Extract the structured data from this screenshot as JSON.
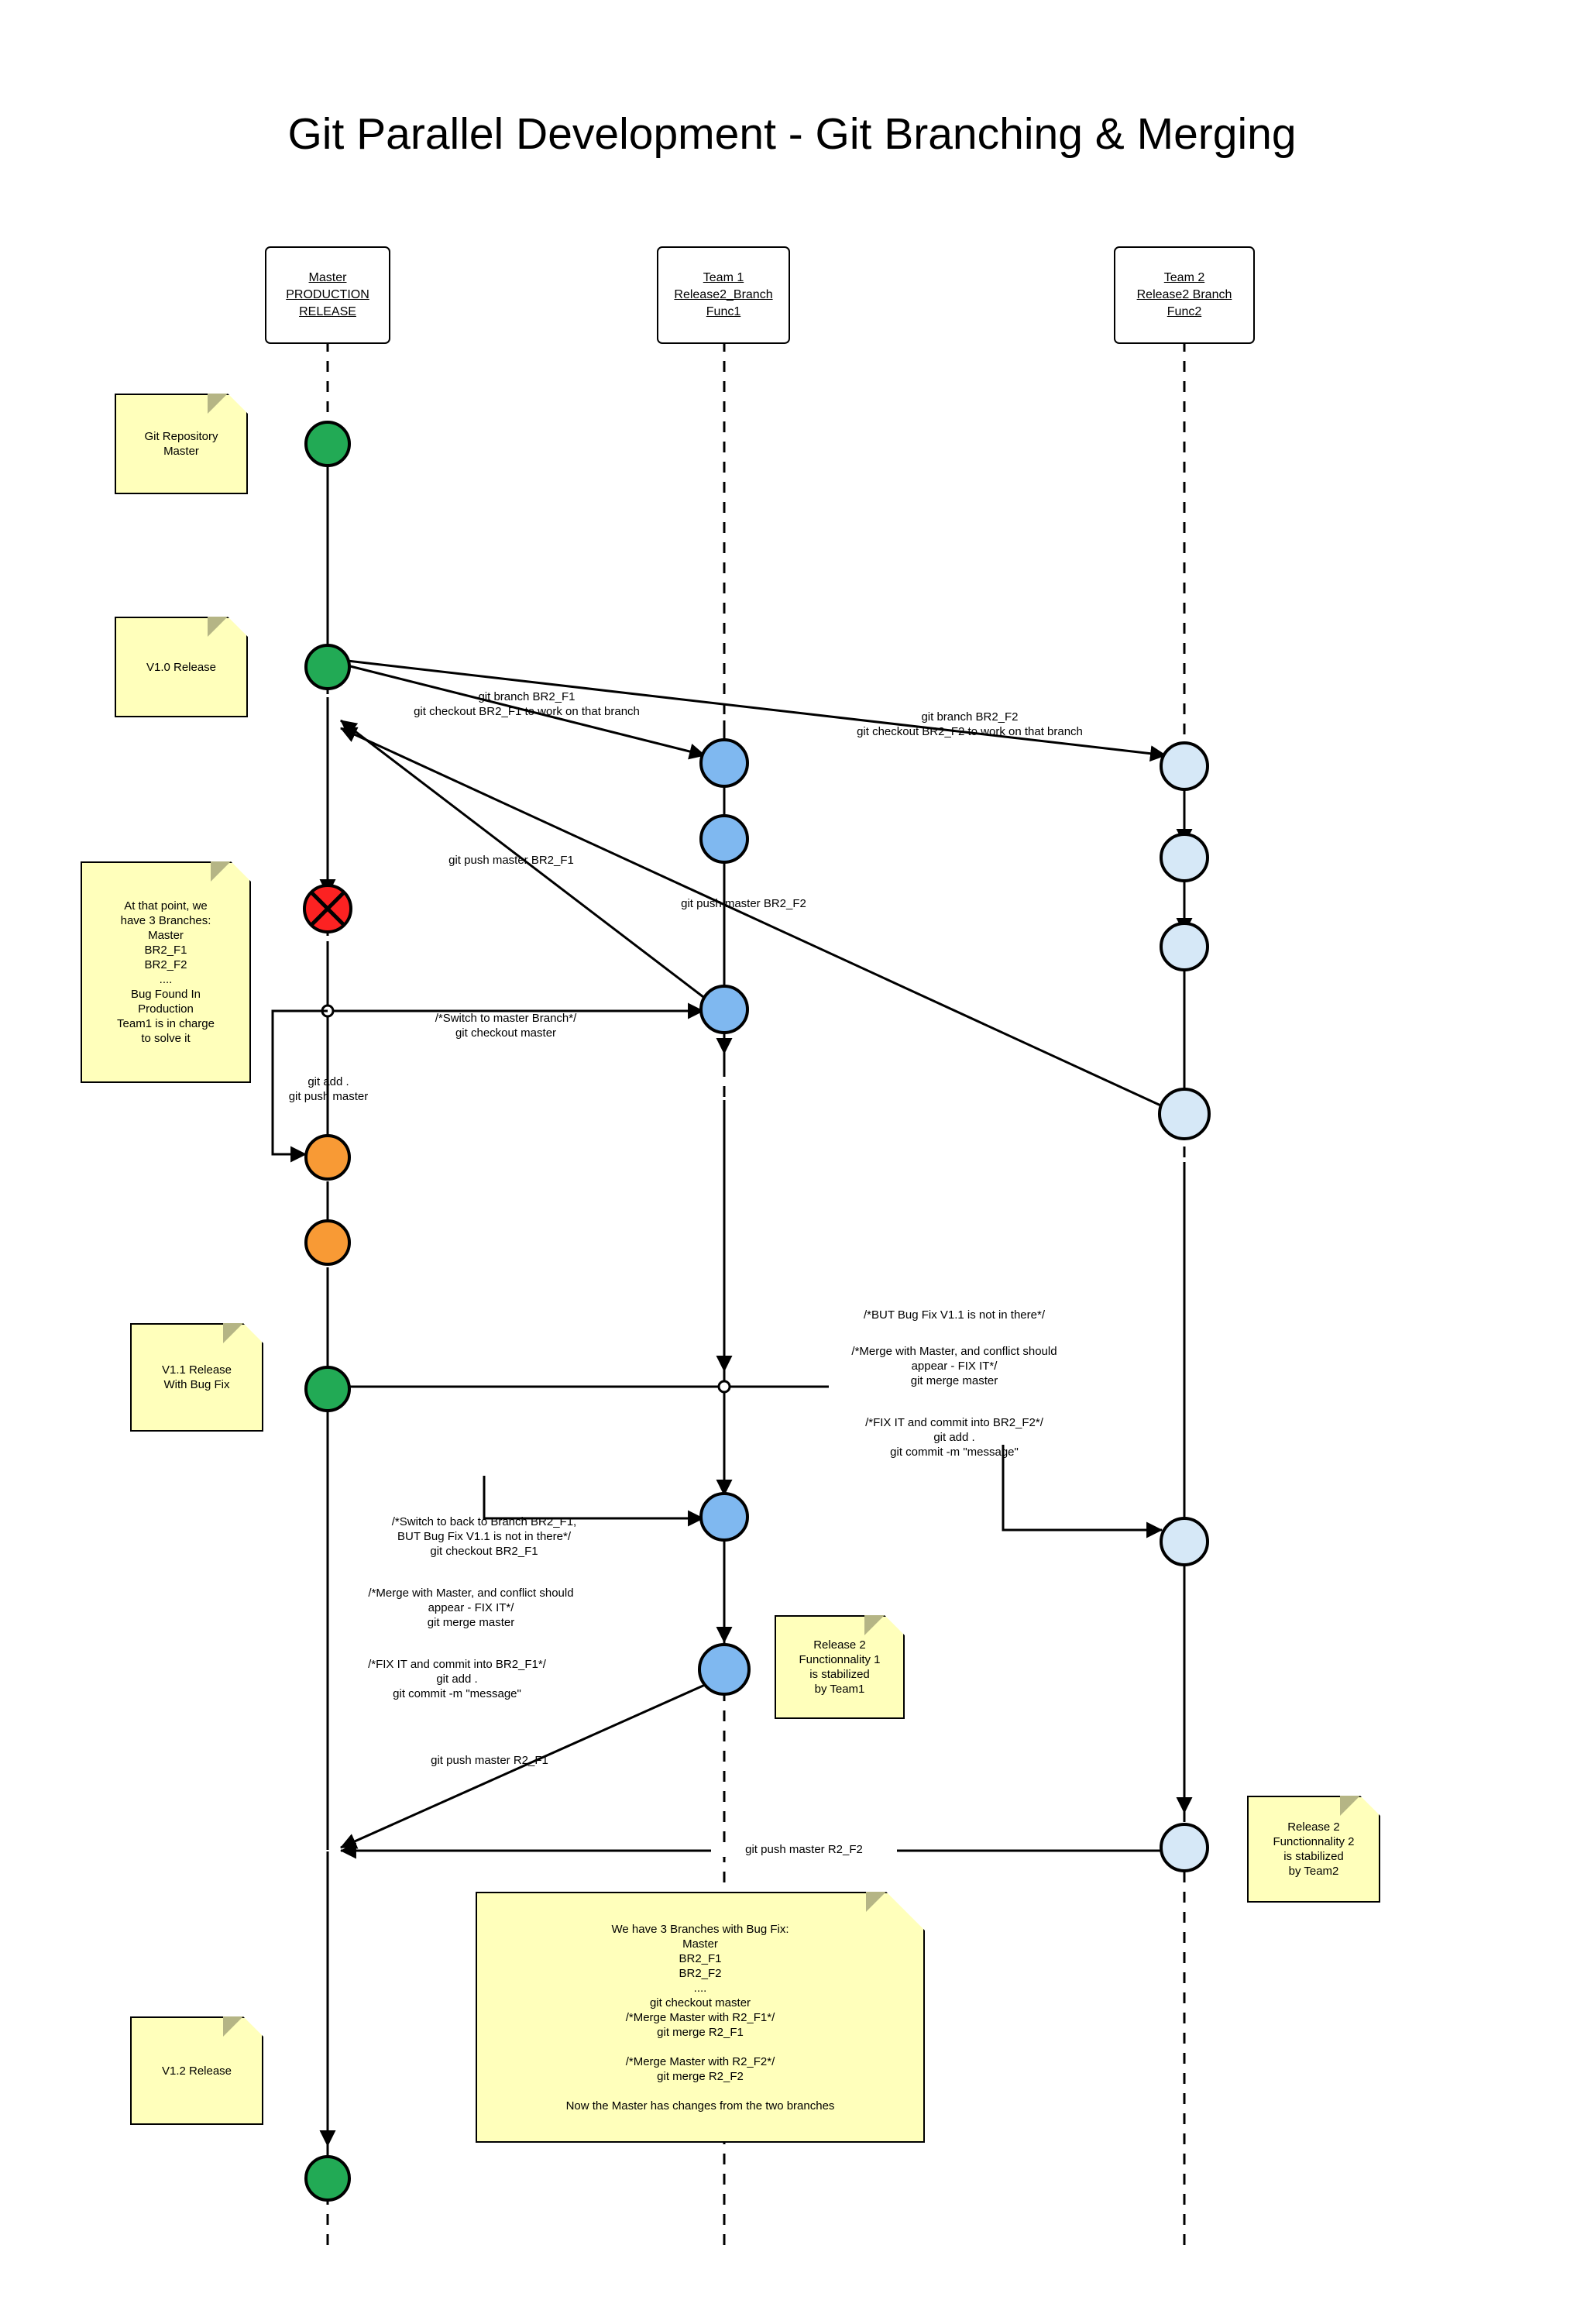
{
  "title": "Git Parallel Development - Git Branching & Merging",
  "colors": {
    "master_node": "#22aa55",
    "bug_node": "#fc2222",
    "fix_node": "#f89a35",
    "team1_node": "#7fb8f0",
    "team2_node": "#d6e8f7",
    "note_bg": "#ffffbb",
    "note_fold": "#b5b585",
    "stroke": "#000000",
    "background": "#ffffff"
  },
  "lifelines": [
    {
      "id": "master",
      "lines": [
        "Master",
        "PRODUCTION",
        "RELEASE"
      ]
    },
    {
      "id": "team1",
      "lines": [
        "Team 1",
        "Release2_Branch",
        "Func1"
      ]
    },
    {
      "id": "team2",
      "lines": [
        "Team 2",
        "Release2 Branch",
        "Func2"
      ]
    }
  ],
  "notes": [
    {
      "id": "git-repository-master",
      "text": "Git Repository\nMaster"
    },
    {
      "id": "v10-release",
      "text": "V1.0 Release"
    },
    {
      "id": "three-branches",
      "text": "At that point, we\nhave 3 Branches:\nMaster\nBR2_F1\nBR2_F2\n....\nBug Found In\nProduction\nTeam1 is in charge\nto solve it"
    },
    {
      "id": "v11-release",
      "text": "V1.1 Release\nWith Bug Fix"
    },
    {
      "id": "release2-func1",
      "text": "Release 2\nFunctionnality 1\nis stabilized\nby Team1"
    },
    {
      "id": "release2-func2",
      "text": "Release 2\nFunctionnality 2\nis stabilized\nby Team2"
    },
    {
      "id": "merge-summary",
      "text": "We have 3 Branches with Bug Fix:\nMaster\nBR2_F1\nBR2_F2\n....\ngit checkout master\n/*Merge Master with R2_F1*/\ngit merge R2_F1\n\n/*Merge Master with R2_F2*/\ngit merge R2_F2\n\nNow the Master has changes from the two branches"
    },
    {
      "id": "v12-release",
      "text": "V1.2 Release"
    }
  ],
  "edge_labels": [
    {
      "id": "branch-br2-f1",
      "text": "git branch BR2_F1\ngit checkout BR2_F1 to work on that branch"
    },
    {
      "id": "branch-br2-f2",
      "text": "git branch BR2_F2\ngit checkout BR2_F2 to work on that branch"
    },
    {
      "id": "push-master-br2-f1",
      "text": "git push master BR2_F1"
    },
    {
      "id": "push-master-br2-f2",
      "text": "git push master BR2_F2"
    },
    {
      "id": "switch-to-master",
      "text": "/*Switch to master Branch*/\ngit checkout master"
    },
    {
      "id": "git-add-push-master",
      "text": "git add .\ngit push master"
    },
    {
      "id": "bugfix-not-in-there-f2",
      "text": "/*BUT Bug Fix V1.1 is not in there*/"
    },
    {
      "id": "merge-master-conflict-f2",
      "text": "/*Merge with Master, and conflict should\nappear  - FIX IT*/\ngit merge master"
    },
    {
      "id": "fix-commit-br2-f2",
      "text": "/*FIX IT and commit into BR2_F2*/\ngit add .\ngit commit -m \"message\""
    },
    {
      "id": "switch-back-br2-f1",
      "text": "/*Switch to back to Branch BR2_F1,\nBUT Bug Fix V1.1 is not in there*/\ngit checkout BR2_F1"
    },
    {
      "id": "merge-master-conflict-f1",
      "text": "/*Merge with Master, and conflict should\nappear  - FIX IT*/\ngit merge master"
    },
    {
      "id": "fix-commit-br2-f1",
      "text": "/*FIX IT and commit into BR2_F1*/\ngit add .\ngit commit -m \"message\""
    },
    {
      "id": "push-master-r2-f1",
      "text": "git push master R2_F1"
    },
    {
      "id": "push-master-r2-f2",
      "text": "git push master R2_F2"
    }
  ],
  "nodes": [
    {
      "id": "master-initial",
      "lifeline": "master",
      "kind": "release"
    },
    {
      "id": "master-v10",
      "lifeline": "master",
      "kind": "release"
    },
    {
      "id": "master-bug",
      "lifeline": "master",
      "kind": "bug"
    },
    {
      "id": "master-fix-1",
      "lifeline": "master",
      "kind": "fix"
    },
    {
      "id": "master-fix-2",
      "lifeline": "master",
      "kind": "fix"
    },
    {
      "id": "master-v11",
      "lifeline": "master",
      "kind": "release"
    },
    {
      "id": "master-v12",
      "lifeline": "master",
      "kind": "release"
    },
    {
      "id": "team1-commit-1",
      "lifeline": "team1",
      "kind": "team1"
    },
    {
      "id": "team1-commit-2",
      "lifeline": "team1",
      "kind": "team1"
    },
    {
      "id": "team1-commit-3",
      "lifeline": "team1",
      "kind": "team1"
    },
    {
      "id": "team1-commit-4",
      "lifeline": "team1",
      "kind": "team1"
    },
    {
      "id": "team1-commit-5",
      "lifeline": "team1",
      "kind": "team1"
    },
    {
      "id": "team2-commit-1",
      "lifeline": "team2",
      "kind": "team2"
    },
    {
      "id": "team2-commit-2",
      "lifeline": "team2",
      "kind": "team2"
    },
    {
      "id": "team2-commit-3",
      "lifeline": "team2",
      "kind": "team2"
    },
    {
      "id": "team2-commit-4",
      "lifeline": "team2",
      "kind": "team2"
    },
    {
      "id": "team2-commit-5",
      "lifeline": "team2",
      "kind": "team2"
    },
    {
      "id": "team2-commit-6",
      "lifeline": "team2",
      "kind": "team2"
    }
  ]
}
